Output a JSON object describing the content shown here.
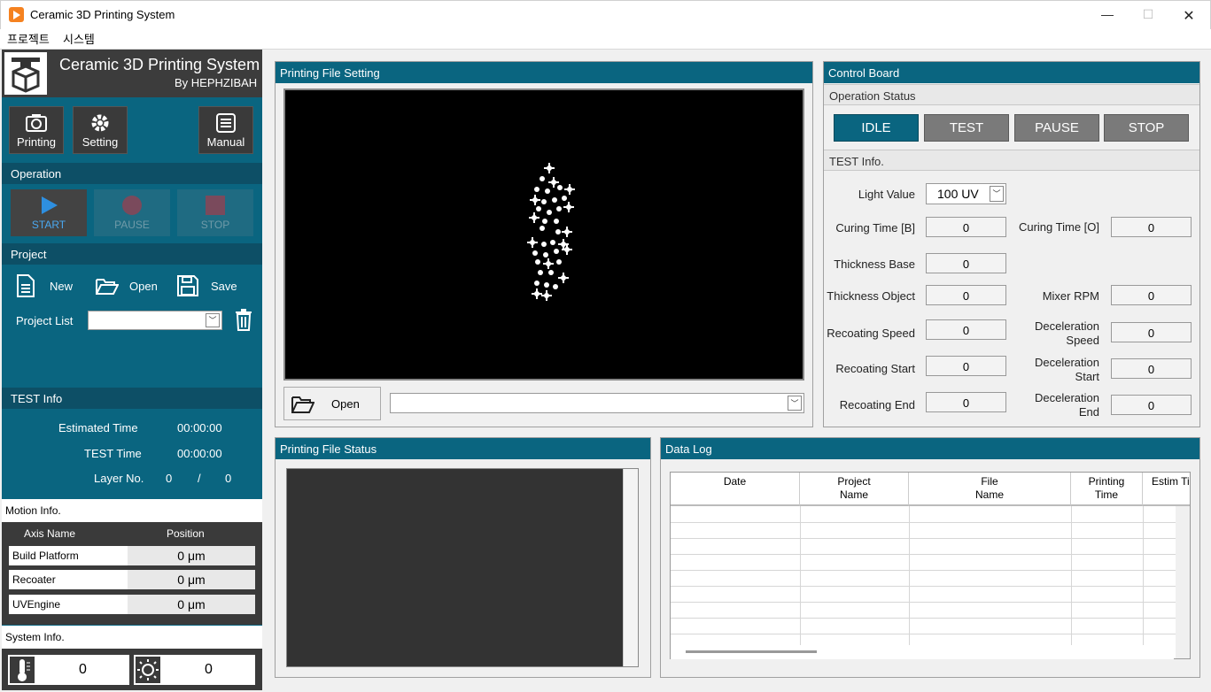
{
  "window": {
    "title": "Ceramic 3D Printing System",
    "min": "—",
    "max": "☐",
    "close": "✕"
  },
  "menu": [
    {
      "label": "프로젝트"
    },
    {
      "label": "시스템"
    }
  ],
  "sidebar": {
    "title": "Ceramic 3D Printing System",
    "subtitle": "By HEPHZIBAH",
    "tools": [
      {
        "label": "Printing"
      },
      {
        "label": "Setting"
      },
      {
        "label": "Manual"
      }
    ],
    "operation": {
      "header": "Operation",
      "start": "START",
      "pause": "PAUSE",
      "stop": "STOP"
    },
    "project": {
      "header": "Project",
      "new": "New",
      "open": "Open",
      "save": "Save",
      "list_label": "Project List",
      "list_value": ""
    },
    "test_info": {
      "header": "TEST Info",
      "estimated_label": "Estimated  Time",
      "estimated_value": "00:00:00",
      "test_time_label": "TEST Time",
      "test_time_value": "00:00:00",
      "layer_label": "Layer No.",
      "layer_current": "0",
      "layer_sep": "/",
      "layer_total": "0"
    },
    "motion": {
      "header": "Motion Info.",
      "col_axis": "Axis Name",
      "col_pos": "Position",
      "axes": [
        {
          "name": "Build Platform",
          "pos": "0 μm"
        },
        {
          "name": "Recoater",
          "pos": "0 μm"
        },
        {
          "name": "UVEngine",
          "pos": "0 μm"
        }
      ]
    },
    "system": {
      "header": "System Info.",
      "temp": "0",
      "light": "0",
      "temp_icon": "thermometer-icon",
      "light_icon": "sun-icon"
    }
  },
  "file_setting": {
    "header": "Printing File Setting",
    "open": "Open",
    "file_value": ""
  },
  "file_status": {
    "header": "Printing File Status"
  },
  "control": {
    "header": "Control Board",
    "op_status": "Operation Status",
    "states": [
      "IDLE",
      "TEST",
      "PAUSE",
      "STOP"
    ],
    "active_state": "IDLE",
    "test_info": "TEST Info.",
    "light_label": "Light Value",
    "light_value": "100 UV",
    "curing_b_label": "Curing Time [B]",
    "curing_b": "0",
    "curing_o_label": "Curing Time [O]",
    "curing_o": "0",
    "thick_base_label": "Thickness Base",
    "thick_base": "0",
    "thick_obj_label": "Thickness Object",
    "thick_obj": "0",
    "mixer_label": "Mixer RPM",
    "mixer": "0",
    "recoat_speed_label": "Recoating Speed",
    "recoat_speed": "0",
    "decel_speed_label": "Deceleration Speed",
    "decel_speed": "0",
    "recoat_start_label": "Recoating Start",
    "recoat_start": "0",
    "decel_start_label": "Deceleration Start",
    "decel_start": "0",
    "recoat_end_label": "Recoating End",
    "recoat_end": "0",
    "decel_end_label": "Deceleration End",
    "decel_end": "0"
  },
  "data_log": {
    "header": "Data Log",
    "columns": [
      "Date",
      "Project Name",
      "File Name",
      "Printing Time",
      "Estim Ti"
    ]
  }
}
